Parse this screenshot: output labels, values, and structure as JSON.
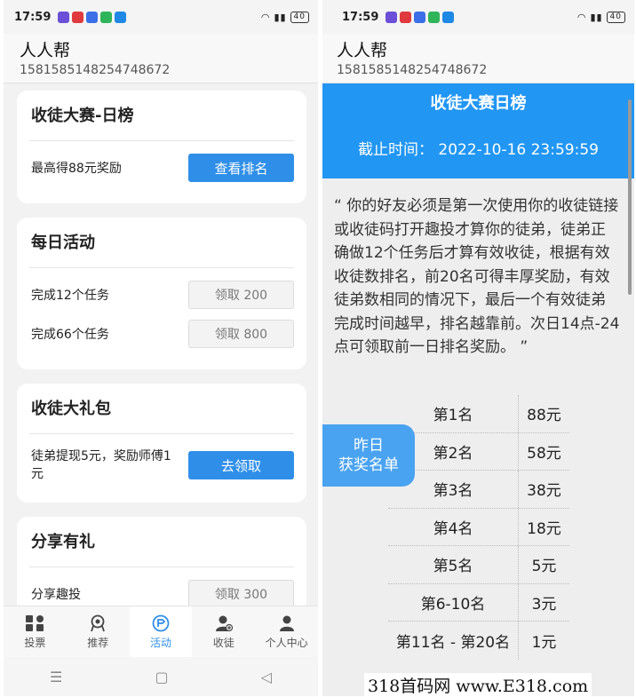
{
  "status": {
    "time": "17:59",
    "battery": "40"
  },
  "app": {
    "title": "人人帮",
    "user_id": "1581585148254748672"
  },
  "left": {
    "cards": {
      "daily_rank": {
        "title": "收徒大赛-日榜",
        "desc": "最高得88元奖励",
        "button": "查看排名"
      },
      "daily_activity": {
        "title": "每日活动",
        "rows": [
          {
            "desc": "完成12个任务",
            "button": "领取 200"
          },
          {
            "desc": "完成66个任务",
            "button": "领取 800"
          }
        ]
      },
      "gift": {
        "title": "收徒大礼包",
        "desc": "徒弟提现5元，奖励师傅1元",
        "button": "去领取"
      },
      "share": {
        "title": "分享有礼",
        "desc": "分享趣投",
        "button": "领取 300"
      }
    },
    "tabs": [
      {
        "label": "投票",
        "icon": "vote-icon"
      },
      {
        "label": "推荐",
        "icon": "recommend-icon"
      },
      {
        "label": "活动",
        "icon": "activity-icon",
        "active": true
      },
      {
        "label": "收徒",
        "icon": "add-disciple-icon"
      },
      {
        "label": "个人中心",
        "icon": "profile-icon"
      }
    ]
  },
  "right": {
    "header_title": "收徒大赛日榜",
    "deadline": "截止时间：  2022-10-16 23:59:59",
    "rules": "“ 你的好友必须是第一次使用你的收徒链接或收徒码打开趣投才算你的徒弟，徒弟正确做12个任务后才算有效收徒，根据有效收徒数排名，前20名可得丰厚奖励，有效徒弟数相同的情况下，最后一个有效徒弟完成时间越早，排名越靠前。次日14点-24点可领取前一日排名奖励。 ”",
    "yesterday_btn_line1": "昨日",
    "yesterday_btn_line2": "获奖名单",
    "ranks": [
      {
        "rank": "第1名",
        "prize": "88元"
      },
      {
        "rank": "第2名",
        "prize": "58元"
      },
      {
        "rank": "第3名",
        "prize": "38元"
      },
      {
        "rank": "第4名",
        "prize": "18元"
      },
      {
        "rank": "第5名",
        "prize": "5元"
      },
      {
        "rank": "第6-10名",
        "prize": "3元"
      },
      {
        "rank": "第11名 - 第20名",
        "prize": "1元"
      }
    ]
  },
  "watermark": "318首码网 www.E318.com",
  "colors": {
    "primary": "#2f8fe8",
    "header_blue": "#2196f3"
  }
}
